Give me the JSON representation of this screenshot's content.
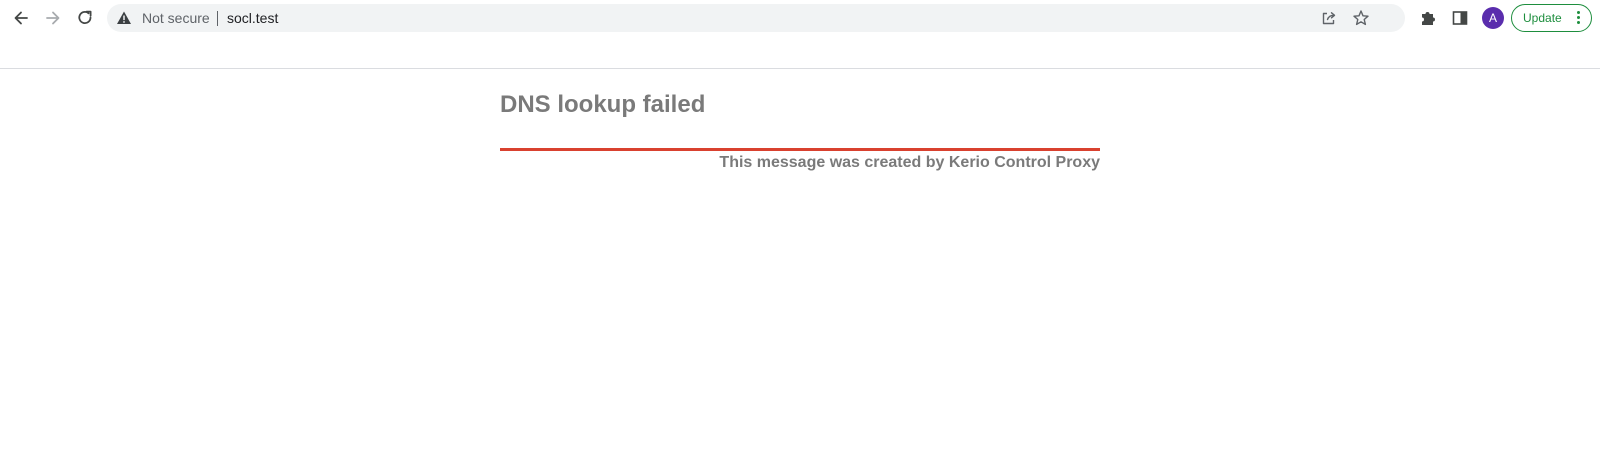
{
  "browser": {
    "security_label": "Not secure",
    "url": "socl.test",
    "profile_initial": "A",
    "update_label": "Update",
    "icons": {
      "back": "arrow-left-icon",
      "forward": "arrow-right-icon",
      "reload": "reload-icon",
      "security": "warning-triangle-icon",
      "share": "share-icon",
      "bookmark": "star-icon",
      "extensions": "puzzle-icon",
      "side_panel": "side-panel-icon",
      "menu": "kebab-menu-icon"
    },
    "colors": {
      "update_accent": "#1e8e3e",
      "avatar_bg": "#5a2dad"
    }
  },
  "page": {
    "title": "DNS lookup failed",
    "footer": "This message was created by Kerio Control Proxy",
    "colors": {
      "text": "#7a7a7a",
      "rule": "#d9412f"
    }
  }
}
